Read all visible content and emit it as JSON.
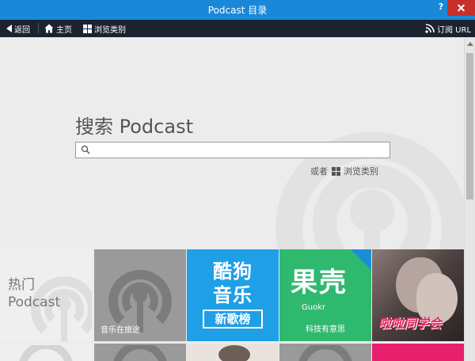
{
  "window": {
    "title": "Podcast 目录",
    "help_label": "?",
    "close_label": "✕"
  },
  "toolbar": {
    "back_label": "返回",
    "home_label": "主页",
    "browse_label": "浏览类别",
    "subscribe_url_label": "订阅 URL"
  },
  "search": {
    "heading": "搜索 Podcast",
    "value": "",
    "placeholder": "",
    "or_label": "或者",
    "browse_label": "浏览类别"
  },
  "tiles": {
    "hot": {
      "line1": "热门",
      "line2": "Podcast"
    },
    "music_travel": {
      "label": "音乐在旅途"
    },
    "kugou": {
      "line1": "酷狗",
      "line2": "音乐",
      "sub": "新歌榜"
    },
    "guokr": {
      "title": "果壳",
      "en": "Guokr",
      "sub": "科技有意思"
    },
    "lala": {
      "title": "啦啦同学会"
    }
  },
  "colors": {
    "titlebar": "#1a88d9",
    "toolbar": "#1b2330",
    "close": "#c7302a",
    "kugou": "#1f9fe6",
    "guokr": "#2fb96f",
    "lala_accent": "#e82868"
  },
  "icons": {
    "back": "back-arrow-icon",
    "home": "home-icon",
    "browse": "grid-icon",
    "rss": "rss-icon",
    "search": "search-icon",
    "podcast": "podcast-icon"
  }
}
